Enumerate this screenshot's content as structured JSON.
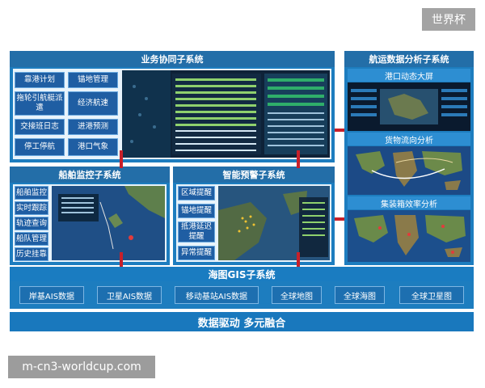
{
  "watermark": {
    "top": "世界杯",
    "bottom": "m-cn3-worldcup.com"
  },
  "business": {
    "title": "业务协同子系统",
    "col1": [
      "靠港计划",
      "拖轮引航艇派遣",
      "交接班日志",
      "停工停航"
    ],
    "col2": [
      "锚地管理",
      "经济航速",
      "进港预测",
      "港口气象"
    ]
  },
  "ship": {
    "title": "船舶监控子系统",
    "items": [
      "船舶监控",
      "实时跟踪",
      "轨迹查询",
      "船队管理",
      "历史挂靠"
    ]
  },
  "alert": {
    "title": "智能预警子系统",
    "items": [
      "区域提醒",
      "锚地提醒",
      "抵港延迟提醒",
      "异常提醒"
    ]
  },
  "analytics": {
    "title": "航运数据分析子系统",
    "sections": [
      "港口动态大屏",
      "货物流向分析",
      "集装箱效率分析"
    ]
  },
  "gis": {
    "title": "海图GIS子系统",
    "chips": [
      "岸基AIS数据",
      "卫星AIS数据",
      "移动基站AIS数据",
      "全球地图",
      "全球海图",
      "全球卫星图"
    ]
  },
  "footer": {
    "slogan": "数据驱动 多元融合"
  },
  "colors": {
    "panel": "#1d7dbf",
    "title": "#236ea8",
    "button": "#1f5ea3",
    "arrow": "#c8202a"
  }
}
